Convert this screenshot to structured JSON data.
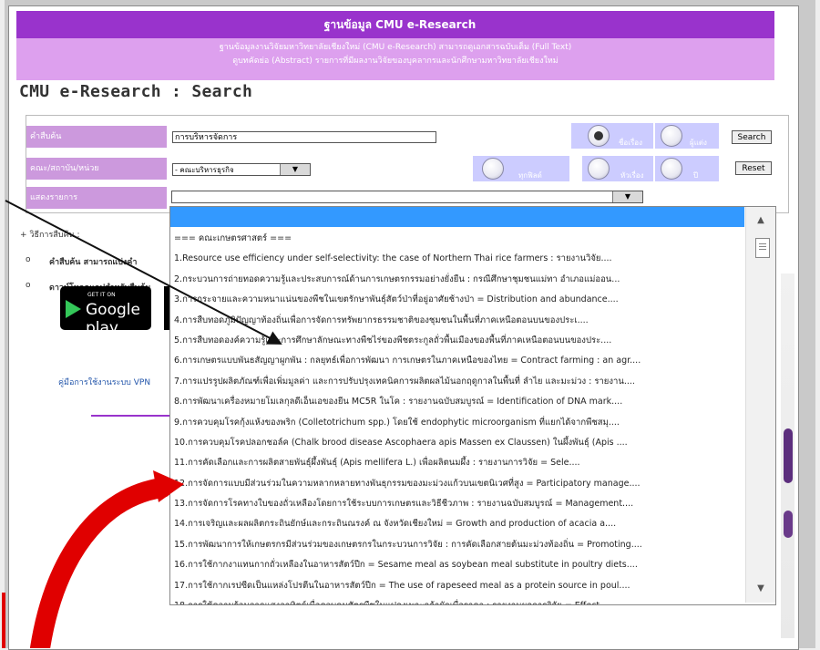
{
  "banner": {
    "title": "ฐานข้อมูล CMU e-Research"
  },
  "subbanner": {
    "line1": "ฐานข้อมูลงานวิจัยมหาวิทยาลัยเชียงใหม่ (CMU e-Research) สามารถดูเอกสารฉบับเต็ม (Full Text)",
    "line2": "ดูบทคัดย่อ (Abstract) รายการที่มีผลงานวิจัยของบุคลากรและนักศึกษามหาวิทยาลัยเชียงใหม่"
  },
  "page": {
    "title": "CMU e-Research : Search"
  },
  "form": {
    "keyword_label": "คำสืบค้น",
    "keyword_value": "การบริหารจัดการ",
    "faculty_label": "คณะ/สถาบัน/หน่วย",
    "faculty_value": "- คณะบริหารธุรกิจ",
    "display_label": "แสดงรายการ",
    "radio_title": "ชื่อเรื่อง",
    "radio_author": "ผู้แต่ง",
    "radio_all": "ทุกฟิลด์",
    "radio_subject": "หัวเรื่อง",
    "radio_year": "ปี",
    "search_button": "Search",
    "reset_button": "Reset"
  },
  "left": {
    "header": "+ วิธีการสืบค้น :",
    "bullet1": "คำสืบค้น สามารถแบ่งคำ",
    "bullet2": "ดาวน์โหลดแอปสำหรับสืบค้น",
    "gp_small": "GET IT ON",
    "gp_big": "Google play",
    "vpn_link": "คู่มือการใช้งานระบบ VPN"
  },
  "list": {
    "items": [
      "=== คณะเกษตรศาสตร์ ===",
      "1.Resource use efficiency under self-selectivity: the case of Northern Thai rice farmers : รายงานวิจัย....",
      "2.กระบวนการถ่ายทอดความรู้และประสบการณ์ด้านการเกษตรกรรมอย่างยั่งยืน : กรณีศึกษาชุมชนแม่ทา อำเภอแม่ออน...",
      "3.การกระจายและความหนาแน่นของพืชในเขตรักษาพันธุ์สัตว์ป่าที่อยู่อาศัยช้างป่า = Distribution and abundance....",
      "4.การสืบทอดภูมิปัญญาท้องถิ่นเพื่อการจัดการทรัพยากรธรรมชาติของชุมชนในพื้นที่ภาคเหนือตอนบนของประเ....",
      "5.การสืบทอดองค์ความรู้และการศึกษาลักษณะทางพืชไร่ของพืชตระกูลถั่วพื้นเมืองของพื้นที่ภาคเหนือตอนบนของประ....",
      "6.การเกษตรแบบพันธสัญญาผูกพัน : กลยุทธ์เพื่อการพัฒนา การเกษตรในภาคเหนือของไทย = Contract farming : an agr....",
      "7.การแปรรูปผลิตภัณฑ์เพื่อเพิ่มมูลค่า และการปรับปรุงเทคนิคการผลิตผลไม้นอกฤดูกาลในพื้นที่ ลำไย และมะม่วง : รายงาน....",
      "8.การพัฒนาเครื่องหมายโมเลกุลดีเอ็นเอของยีน MC5R ในโค : รายงานฉบับสมบูรณ์ = Identification of DNA mark....",
      "9.การควบคุมโรคกุ้งแห้งของพริก (Colletotrichum spp.) โดยใช้ endophytic microorganism ที่แยกได้จากพืชสมุ....",
      "10.การควบคุมโรคปลอกชอล์ค (Chalk brood disease Ascophaera apis Massen ex Claussen) ในผึ้งพันธุ์ (Apis ....",
      "11.การคัดเลือกและการผลิตสายพันธุ์ผึ้งพันธุ์ (Apis mellifera L.) เพื่อผลิตนมผึ้ง : รายงานการวิจัย = Sele....",
      "12.การจัดการแบบมีส่วนร่วมในความหลากหลายทางพันธุกรรมของมะม่วงแก้วบนเขตนิเวศที่สูง = Participatory manage....",
      "13.การจัดการโรคทางใบของถั่วเหลืองโดยการใช้ระบบการเกษตรและวิธีชีวภาพ : รายงานฉบับสมบูรณ์ = Management....",
      "14.การเจริญและผลผลิตกระถินยักษ์และกระถินณรงค์ ณ จังหวัดเชียงใหม่ = Growth and production of acacia a....",
      "15.การพัฒนาการให้เกษตรกรมีส่วนร่วมของเกษตรกรในกระบวนการวิจัย : การคัดเลือกสายต้นมะม่วงท้องถิ่น = Promoting....",
      "16.การใช้กากงาแทนกากถั่วเหลืองในอาหารสัตว์ปีก = Sesame meal as soybean meal substitute in poultry diets....",
      "17.การใช้กากเรปซีดเป็นแหล่งโปรตีนในอาหารสัตว์ปีก = The use of rapeseed meal as a protein source in poul....",
      "18.การใช้ความร้อนจากแสงอาทิตย์เพื่อควบคุมศัตรูพืชในแปลงเพาะกล้าผักเพื่อราคา : รายงานผลการวิจัย = Effect...."
    ]
  }
}
